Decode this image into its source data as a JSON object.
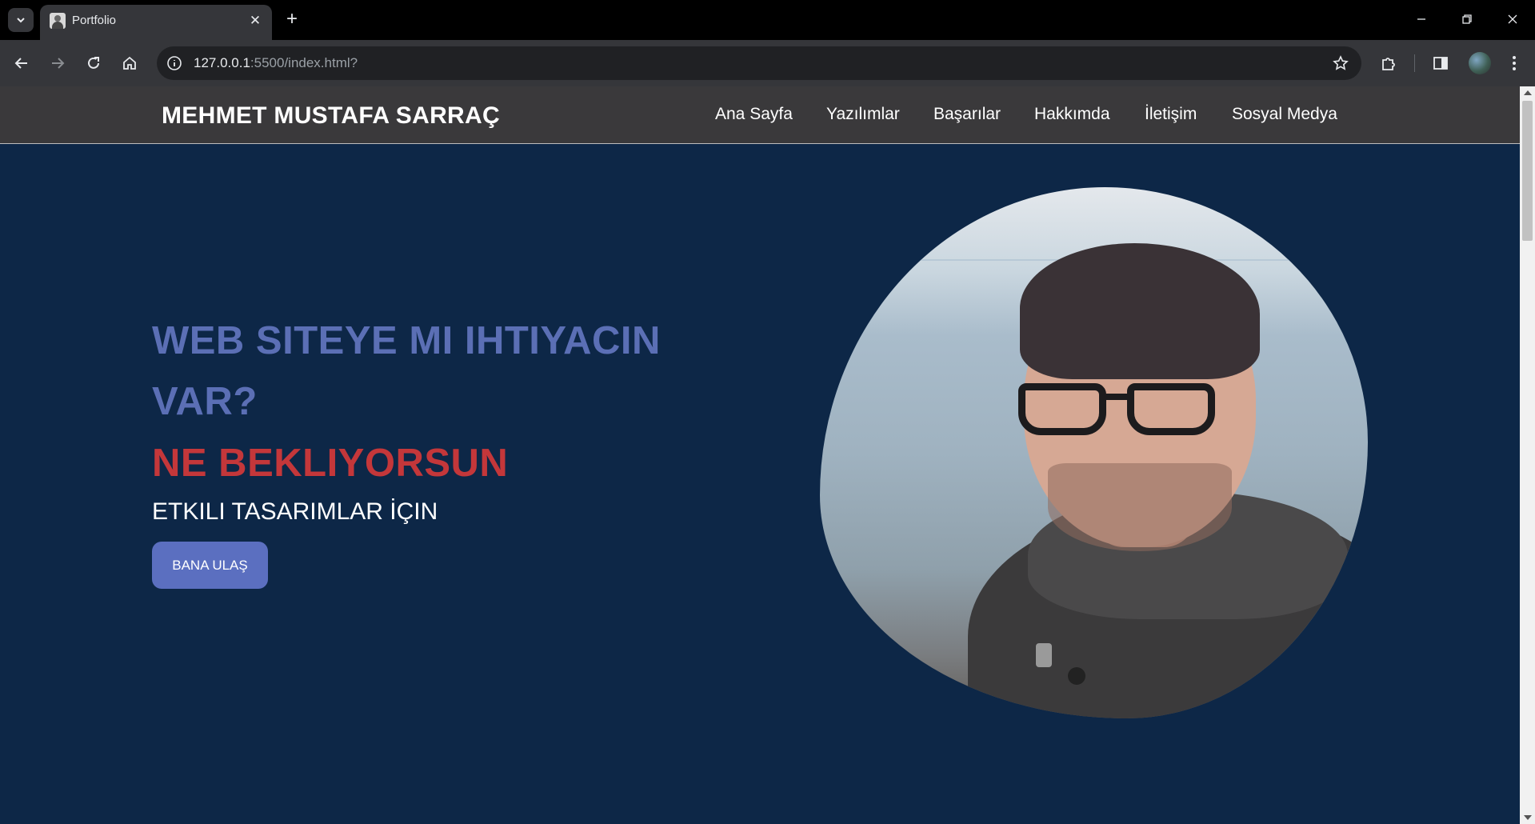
{
  "browser": {
    "tab": {
      "title": "Portfolio"
    },
    "address": {
      "host": "127.0.0.1",
      "rest": ":5500/index.html?"
    }
  },
  "header": {
    "brand": "MEHMET MUSTAFA SARRAÇ",
    "nav": [
      "Ana Sayfa",
      "Yazılımlar",
      "Başarılar",
      "Hakkımda",
      "İletişim",
      "Sosyal Medya"
    ]
  },
  "hero": {
    "line1": "WEB SITEYE MI IHTIYACIN",
    "line2": "VAR?",
    "highlight": "NE BEKLIYORSUN",
    "subtitle": "ETKILI TASARIMLAR İÇIN",
    "cta": "BANA ULAŞ"
  },
  "colors": {
    "page_bg": "#0d2747",
    "header_bg": "#3a393b",
    "title_blue": "#5b6fb5",
    "title_red": "#c4373a",
    "button_bg": "#5b6fc0"
  }
}
